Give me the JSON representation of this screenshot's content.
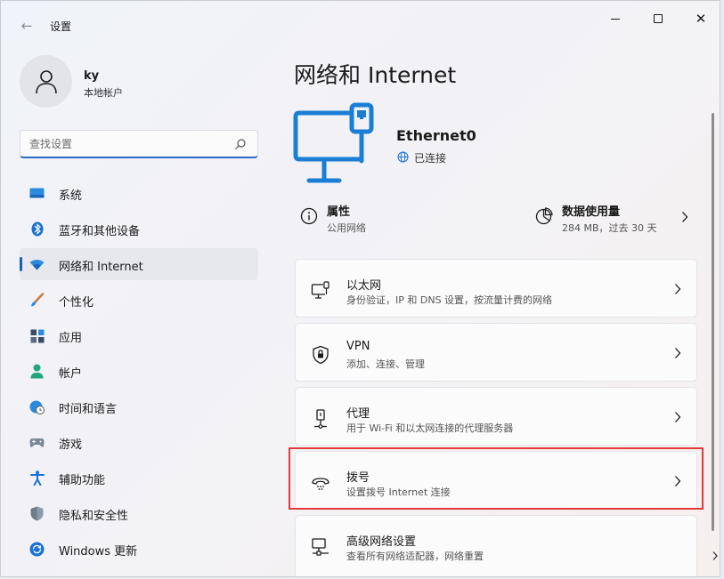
{
  "window": {
    "title": "设置",
    "back_glyph": "←",
    "close_glyph": "✕"
  },
  "profile": {
    "name": "ky",
    "account_type": "本地帐户"
  },
  "search": {
    "placeholder": "查找设置",
    "value": ""
  },
  "nav": {
    "items": [
      {
        "label": "系统",
        "icon": "monitor-icon"
      },
      {
        "label": "蓝牙和其他设备",
        "icon": "bluetooth-icon"
      },
      {
        "label": "网络和 Internet",
        "icon": "wifi-icon",
        "active": true
      },
      {
        "label": "个性化",
        "icon": "brush-icon"
      },
      {
        "label": "应用",
        "icon": "apps-icon"
      },
      {
        "label": "帐户",
        "icon": "person-icon"
      },
      {
        "label": "时间和语言",
        "icon": "globe-clock-icon"
      },
      {
        "label": "游戏",
        "icon": "gamepad-icon"
      },
      {
        "label": "辅助功能",
        "icon": "accessibility-icon"
      },
      {
        "label": "隐私和安全性",
        "icon": "shield-icon"
      },
      {
        "label": "Windows 更新",
        "icon": "update-icon"
      }
    ]
  },
  "main": {
    "title": "网络和 Internet",
    "adapter": {
      "name": "Ethernet0",
      "status": "已连接"
    },
    "properties": {
      "title": "属性",
      "subtitle": "公用网络"
    },
    "data_usage": {
      "title": "数据使用量",
      "subtitle": "284 MB，过去 30 天"
    },
    "cards": [
      {
        "title": "以太网",
        "subtitle": "身份验证，IP 和 DNS 设置，按流量计费的网络",
        "icon": "ethernet-icon"
      },
      {
        "title": "VPN",
        "subtitle": "添加、连接、管理",
        "icon": "vpn-shield-icon"
      },
      {
        "title": "代理",
        "subtitle": "用于 Wi-Fi 和以太网连接的代理服务器",
        "icon": "proxy-icon"
      },
      {
        "title": "拨号",
        "subtitle": "设置拨号 Internet 连接",
        "icon": "dialup-icon"
      },
      {
        "title": "高级网络设置",
        "subtitle": "查看所有网络适配器，网络重置",
        "icon": "advanced-network-icon"
      }
    ]
  },
  "colors": {
    "accent": "#1a5fb4",
    "hero_icon": "#1a7fd4",
    "highlight": "#e5393a"
  }
}
